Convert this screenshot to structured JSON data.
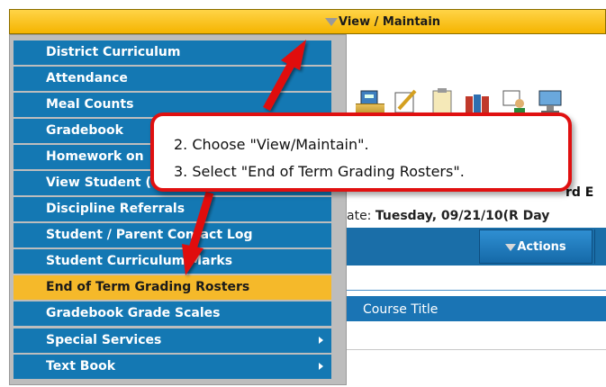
{
  "topbar": {
    "label": "View / Maintain"
  },
  "menu": {
    "items": [
      {
        "label": "District Curriculum",
        "submenu": false,
        "selected": false
      },
      {
        "label": "Attendance",
        "submenu": false,
        "selected": false
      },
      {
        "label": "Meal Counts",
        "submenu": false,
        "selected": false
      },
      {
        "label": "Gradebook",
        "submenu": false,
        "selected": false
      },
      {
        "label": "Homework on",
        "submenu": false,
        "selected": false
      },
      {
        "label": "View Student (",
        "submenu": false,
        "selected": false
      },
      {
        "label": "Discipline Referrals",
        "submenu": false,
        "selected": false
      },
      {
        "label": "Student / Parent Contact Log",
        "submenu": false,
        "selected": false
      },
      {
        "label": "Student Curriculum Marks",
        "submenu": false,
        "selected": false
      },
      {
        "label": "End of Term Grading Rosters",
        "submenu": false,
        "selected": true
      },
      {
        "label": "Gradebook Grade Scales",
        "submenu": false,
        "selected": false
      },
      {
        "label": "Special Services",
        "submenu": true,
        "selected": false
      },
      {
        "label": "Text Book",
        "submenu": true,
        "selected": false
      }
    ]
  },
  "background": {
    "title_partial": "rd E",
    "date_prefix": "ate: ",
    "date_value": "Tuesday, 09/21/10(R Day",
    "actions_label": "Actions",
    "course_title_header": "Course Title"
  },
  "callout": {
    "line1": "2.  Choose \"View/Maintain\".",
    "line2": "3.  Select \"End of Term Grading Rosters\"."
  },
  "colors": {
    "menu_item_bg": "#1478b3",
    "menu_selected_bg": "#f5b92a",
    "topbar_bg": "#f5b400",
    "callout_border": "#e01010"
  }
}
